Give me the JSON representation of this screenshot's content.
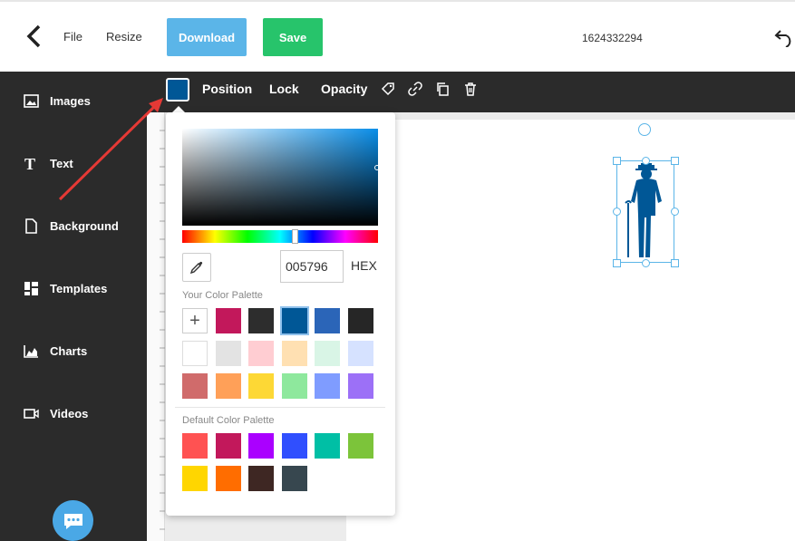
{
  "topbar": {
    "file_label": "File",
    "resize_label": "Resize",
    "download_label": "Download",
    "save_label": "Save",
    "document_name": "1624332294"
  },
  "sidebar": {
    "items": [
      {
        "label": "Images",
        "icon": "image-icon"
      },
      {
        "label": "Text",
        "icon": "text-icon"
      },
      {
        "label": "Background",
        "icon": "file-icon"
      },
      {
        "label": "Templates",
        "icon": "templates-icon"
      },
      {
        "label": "Charts",
        "icon": "chart-icon"
      },
      {
        "label": "Videos",
        "icon": "video-icon"
      }
    ]
  },
  "toolbar": {
    "current_color": "#005796",
    "position_label": "Position",
    "lock_label": "Lock",
    "opacity_label": "Opacity"
  },
  "picker": {
    "hex_value": "005796",
    "hex_label": "HEX",
    "your_palette_label": "Your Color Palette",
    "default_palette_label": "Default Color Palette",
    "your_palette": [
      "#c2185b",
      "#2d2d2d",
      "#005796",
      "#2b65b8",
      "#262626",
      "#ffffff",
      "#e3e3e3",
      "#ffcdd2",
      "#ffe0b2",
      "#d9f5e6",
      "#d6e2ff",
      "#d06b6b",
      "#ffa058",
      "#fdd835",
      "#8ee89d",
      "#7f9cff",
      "#9c70f7"
    ],
    "selected_color": "#005796",
    "default_palette": [
      "#ff5252",
      "#c2185b",
      "#aa00ff",
      "#304ffe",
      "#00bfa5",
      "#7cc43a",
      "#ffd600",
      "#ff6d00",
      "#3e2723",
      "#37474f"
    ]
  }
}
